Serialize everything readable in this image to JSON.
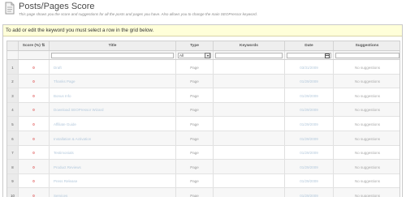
{
  "page": {
    "title": "Posts/Pages Score",
    "description": "This page shows you the score and suggestions for all the posts and pages you have. Also allows you to change the main SEOPressor keyword.",
    "instruction": "To add or edit the keyword you must select a row in the grid below."
  },
  "grid": {
    "columns": {
      "score": "Score (%) ⇅",
      "title": "Title",
      "type": "Type",
      "keywords": "Keywords",
      "date": "Date",
      "suggestions": "Suggestions"
    },
    "filters": {
      "type_selected": "All"
    },
    "rows": [
      {
        "num": "1",
        "score": "0",
        "title": "Draft",
        "type": "Page",
        "keywords": "",
        "date": "03/31/2009",
        "suggestions": "No suggestions"
      },
      {
        "num": "2",
        "score": "0",
        "title": "Thanks Page",
        "type": "Page",
        "keywords": "",
        "date": "01/29/2009",
        "suggestions": "No suggestions"
      },
      {
        "num": "3",
        "score": "0",
        "title": "Bonus Info",
        "type": "Page",
        "keywords": "",
        "date": "01/29/2009",
        "suggestions": "No suggestions"
      },
      {
        "num": "4",
        "score": "0",
        "title": "Download SEOPressor Wizard",
        "type": "Page",
        "keywords": "",
        "date": "01/29/2009",
        "suggestions": "No suggestions"
      },
      {
        "num": "5",
        "score": "0",
        "title": "Affiliate Guide",
        "type": "Page",
        "keywords": "",
        "date": "01/29/2009",
        "suggestions": "No suggestions"
      },
      {
        "num": "6",
        "score": "0",
        "title": "Installation & Activation",
        "type": "Page",
        "keywords": "",
        "date": "01/29/2009",
        "suggestions": "No suggestions"
      },
      {
        "num": "7",
        "score": "0",
        "title": "Testimonials",
        "type": "Page",
        "keywords": "",
        "date": "01/29/2009",
        "suggestions": "No suggestions"
      },
      {
        "num": "8",
        "score": "0",
        "title": "Product Reviews",
        "type": "Page",
        "keywords": "",
        "date": "01/29/2009",
        "suggestions": "No suggestions"
      },
      {
        "num": "9",
        "score": "0",
        "title": "Press Release",
        "type": "Page",
        "keywords": "",
        "date": "01/29/2009",
        "suggestions": "No suggestions"
      },
      {
        "num": "10",
        "score": "0",
        "title": "Services",
        "type": "Page",
        "keywords": "",
        "date": "01/29/2009",
        "suggestions": "No suggestions"
      }
    ]
  },
  "colors": {
    "instruction_bg": "#ffffd9",
    "score_red": "#e05a5a",
    "link_faded": "#b4c9dc"
  },
  "icons": {
    "page": "page-icon",
    "select_arrow": "chevron-down-icon",
    "date_picker": "calendar-icon"
  }
}
